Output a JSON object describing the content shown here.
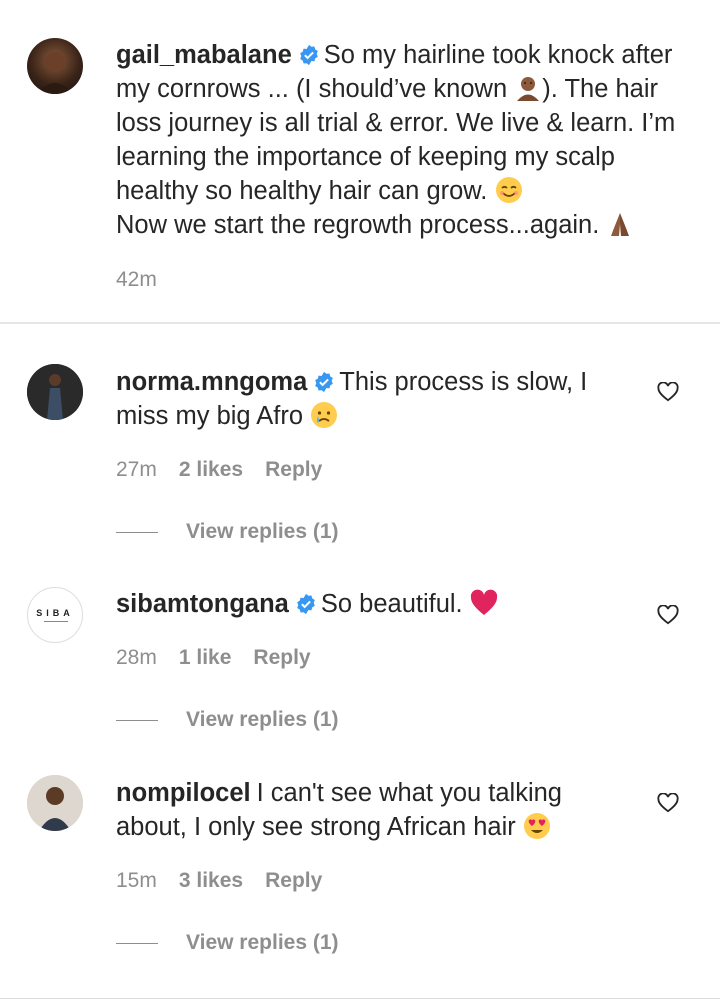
{
  "post": {
    "username": "gail_mabalane",
    "caption_1": "So my hairline took knock after my cornrows ... (I should’ve known",
    "caption_2": "). The hair loss journey is all trial & error. We live & learn. I’m learning the importance of keeping my scalp healthy so healthy hair can grow.",
    "caption_3": "Now we start the regrowth process...again.",
    "time": "42m"
  },
  "comments": [
    {
      "username": "norma.mngoma",
      "text": "This process is slow, I miss my big Afro",
      "time": "27m",
      "likes": "2 likes",
      "reply": "Reply",
      "view_replies": "View replies (1)"
    },
    {
      "username": "sibamtongana",
      "avatar_text": "SIBA",
      "text": "So beautiful.",
      "time": "28m",
      "likes": "1 like",
      "reply": "Reply",
      "view_replies": "View replies (1)"
    },
    {
      "username": "nompilocel",
      "text": "I can't see what you talking about, I only see strong African hair",
      "time": "15m",
      "likes": "3 likes",
      "reply": "Reply",
      "view_replies": "View replies (1)"
    }
  ],
  "colors": {
    "text": "#262626",
    "secondary": "#8e8e8e",
    "verified": "#3897f0",
    "heart_emoji": "#e0245e"
  },
  "icons": {
    "verified": "verified-badge-icon",
    "like": "heart-outline-icon"
  }
}
